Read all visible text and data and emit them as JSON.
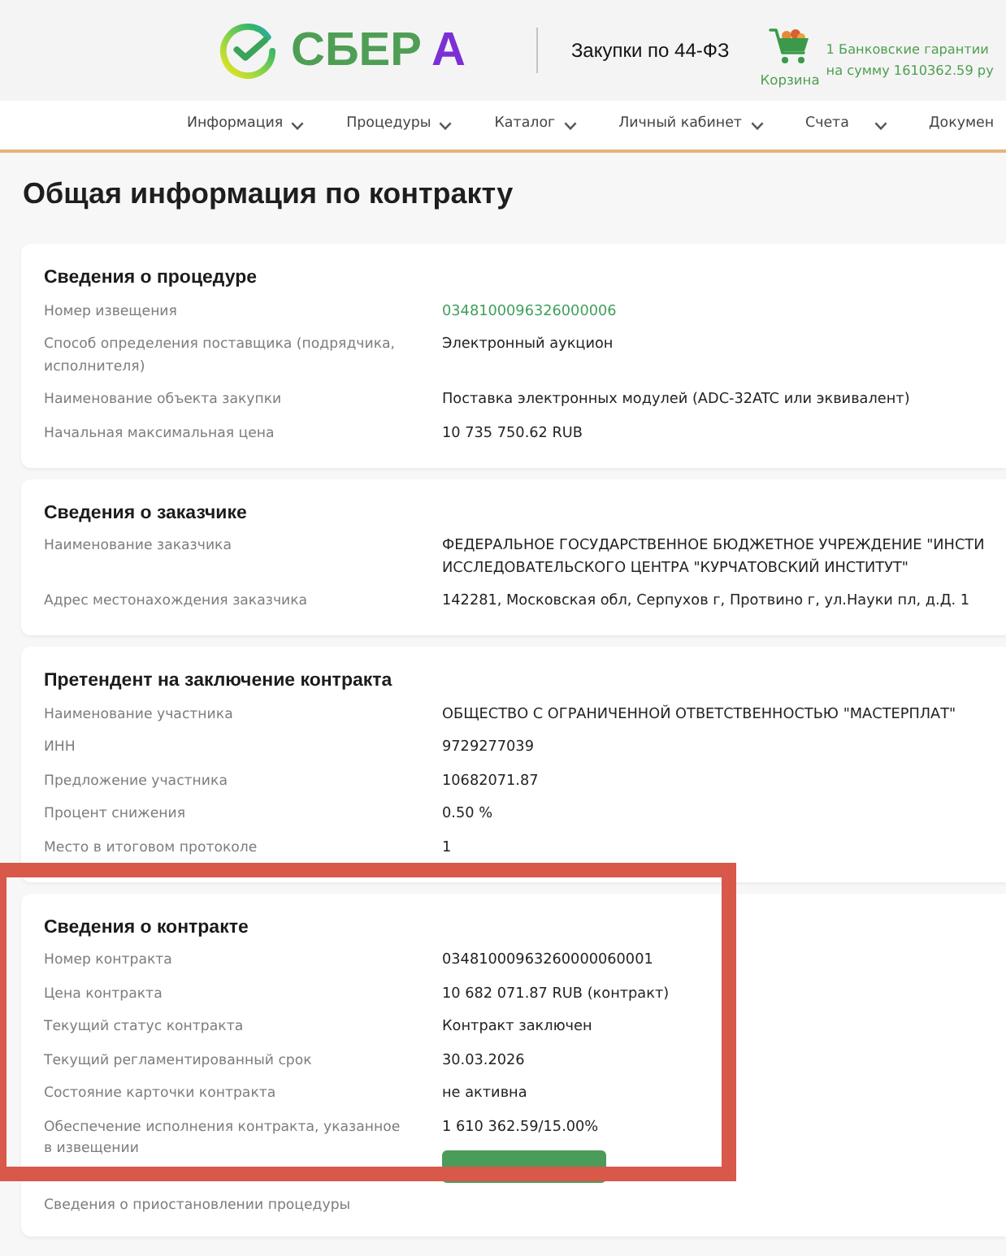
{
  "header": {
    "logo": {
      "wordmark": "СБЕР",
      "letter": "А"
    },
    "title": "Закупки по 44-ФЗ",
    "cart_label": "Корзина",
    "guarantees_link": [
      "1 Банковские гарантии",
      "на сумму 1610362.59 ру"
    ]
  },
  "nav": [
    {
      "label": "Информация",
      "dropdown": true
    },
    {
      "label": "Процедуры",
      "dropdown": true
    },
    {
      "label": "Каталог",
      "dropdown": true
    },
    {
      "label": "Личный кабинет",
      "dropdown": true
    },
    {
      "label": "Счета",
      "dropdown": true
    },
    {
      "label": "Докумен",
      "dropdown": false
    }
  ],
  "page_title": "Общая информация по контракту",
  "sections": [
    {
      "title": "Сведения о процедуре",
      "highlighted": false,
      "rows": [
        {
          "kind": "link",
          "label": "Номер извещения",
          "value": "0348100096326000006"
        },
        {
          "kind": "text",
          "label": "Способ определения поставщика (подрядчика, исполнителя)",
          "value": "Электронный аукцион"
        },
        {
          "kind": "text",
          "label": "Наименование объекта закупки",
          "value": "Поставка электронных модулей (ADC-32ATC или эквивалент)"
        },
        {
          "kind": "text",
          "label": "Начальная максимальная цена",
          "value": "10 735 750.62 RUB"
        }
      ]
    },
    {
      "title": "Сведения о заказчике",
      "highlighted": false,
      "rows": [
        {
          "kind": "text",
          "label": "Наименование заказчика",
          "value": [
            "ФЕДЕРАЛЬНОЕ ГОСУДАРСТВЕННОЕ БЮДЖЕТНОЕ УЧРЕЖДЕНИЕ \"ИНСТИ",
            "ИССЛЕДОВАТЕЛЬСКОГО ЦЕНТРА \"КУРЧАТОВСКИЙ ИНСТИТУТ\""
          ]
        },
        {
          "kind": "text",
          "label": "Адрес местонахождения заказчика",
          "value": "142281, Московская обл, Серпухов г, Протвино г, ул.Науки пл, д.Д. 1"
        }
      ]
    },
    {
      "title": "Претендент на заключение контракта",
      "highlighted": false,
      "rows": [
        {
          "kind": "text",
          "label": "Наименование участника",
          "value": "ОБЩЕСТВО С ОГРАНИЧЕННОЙ ОТВЕТСТВЕННОСТЬЮ \"МАСТЕРПЛАТ\""
        },
        {
          "kind": "text",
          "label": "ИНН",
          "value": "9729277039"
        },
        {
          "kind": "text",
          "label": "Предложение участника",
          "value": "10682071.87"
        },
        {
          "kind": "text",
          "label": "Процент снижения",
          "value": "0.50 %"
        },
        {
          "kind": "text",
          "label": "Место в итоговом протоколе",
          "value": "1"
        }
      ]
    },
    {
      "title": "Сведения о контракте",
      "highlighted": true,
      "rows": [
        {
          "kind": "text",
          "label": "Номер контракта",
          "value": "03481000963260000060001"
        },
        {
          "kind": "text",
          "label": "Цена контракта",
          "value": "10 682 071.87 RUB (контракт)"
        },
        {
          "kind": "text",
          "label": "Текущий статус контракта",
          "value": "Контракт заключен"
        },
        {
          "kind": "text",
          "label": "Текущий регламентированный срок",
          "value": "30.03.2026"
        },
        {
          "kind": "text",
          "label": "Состояние карточки контракта",
          "value": "не активна"
        },
        {
          "kind": "with_button",
          "label": "Обеспечение исполнения контракта, указанное в извещении",
          "value": "1 610 362.59/15.00%"
        }
      ],
      "footer_link": "Сведения о приостановлении процедуры"
    }
  ]
}
